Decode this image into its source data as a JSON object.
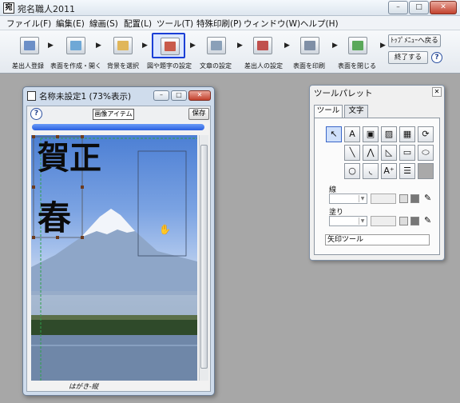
{
  "app": {
    "title": "宛名職人2011",
    "icon_text": "宛"
  },
  "window_controls": {
    "minimize": "–",
    "maximize": "□",
    "close": "✕"
  },
  "menu": [
    "ファイル(F)",
    "編集(E)",
    "線画(S)",
    "配置(L)",
    "ツール(T)",
    "特殊印刷(P)",
    "ウィンドウ(W)",
    "ヘルプ(H)"
  ],
  "toolbar": {
    "items": [
      {
        "label": "差出人登録",
        "icon": "address-card-icon",
        "color": "#6c8fc7"
      },
      {
        "label": "表面を作成・開く",
        "icon": "open-document-icon",
        "color": "#6fa8d6"
      },
      {
        "label": "背景を選択",
        "icon": "background-icon",
        "color": "#e0b65a"
      },
      {
        "label": "図や題字の設定",
        "icon": "figure-title-icon",
        "color": "#c95b4a"
      },
      {
        "label": "文章の設定",
        "icon": "text-settings-icon",
        "color": "#8aa0b8"
      },
      {
        "label": "差出人の設定",
        "icon": "sender-settings-icon",
        "color": "#c0504d"
      },
      {
        "label": "表面を印刷",
        "icon": "printer-icon",
        "color": "#7f8fa6"
      },
      {
        "label": "表面を閉じる",
        "icon": "close-document-icon",
        "color": "#5aa85a"
      }
    ],
    "selected_index": 3,
    "top_menu_back": "ﾄｯﾌﾟﾒﾆｭｰへ戻る",
    "quit": "終了する",
    "help": "?"
  },
  "document": {
    "title": "名称未設定1 (73%表示)",
    "help": "?",
    "image_item_label": "画像アイテム",
    "save_label": "保存",
    "status": "はがき-縦",
    "greeting_text": "賀正",
    "greeting_char2": "春",
    "colors": {
      "sky": "#5f8fd9",
      "lake": "#6f87a8",
      "trees": "#2f4a2a"
    }
  },
  "palette": {
    "title": "ツールパレット",
    "close": "✕",
    "tabs": [
      "ツール",
      "文字"
    ],
    "active_tab": 0,
    "tools": [
      {
        "name": "arrow-tool-icon",
        "glyph": "↖"
      },
      {
        "name": "text-tool-icon",
        "glyph": "A"
      },
      {
        "name": "image-tool-icon",
        "glyph": "▣"
      },
      {
        "name": "pattern-tool-icon",
        "glyph": "▨"
      },
      {
        "name": "qrcode-tool-icon",
        "glyph": "▦"
      },
      {
        "name": "rotate-tool-icon",
        "glyph": "⟳"
      },
      {
        "name": "line-tool-icon",
        "glyph": "╲"
      },
      {
        "name": "polyline-tool-icon",
        "glyph": "⋀"
      },
      {
        "name": "polygon-tool-icon",
        "glyph": "◺"
      },
      {
        "name": "rectangle-tool-icon",
        "glyph": "▭"
      },
      {
        "name": "ellipse-tool-icon",
        "glyph": "⬭"
      },
      {
        "name": "circle-tool-icon",
        "glyph": "○"
      },
      {
        "name": "arc-tool-icon",
        "glyph": "◟"
      },
      {
        "name": "text-frame-tool-icon",
        "glyph": "A⁺"
      },
      {
        "name": "list-tool-icon",
        "glyph": "☰"
      }
    ],
    "line_label": "線",
    "fill_label": "塗り",
    "tool_name": "矢印ツール"
  }
}
